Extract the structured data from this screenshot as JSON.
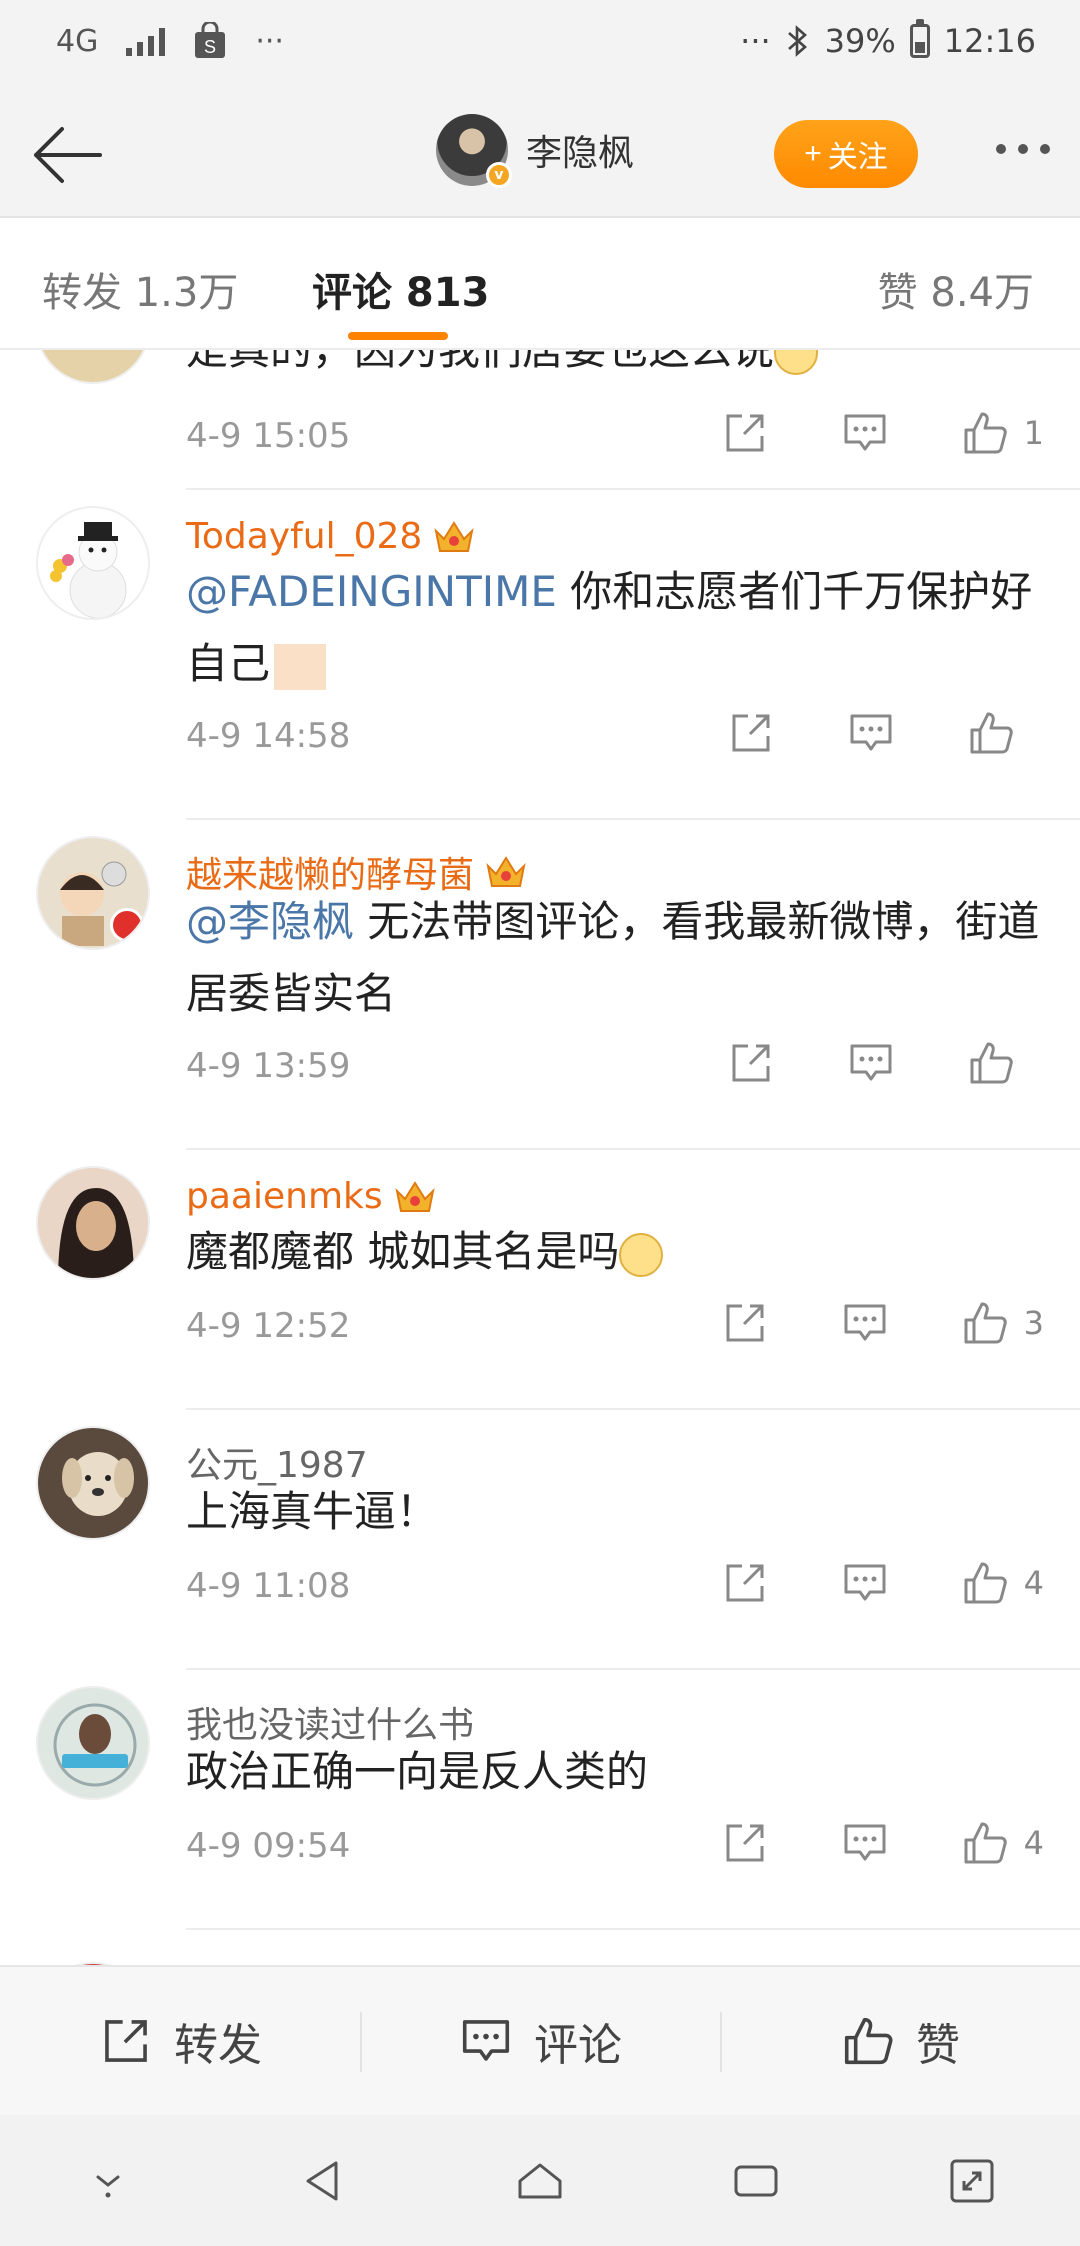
{
  "status_bar": {
    "network": "4G",
    "dots": "···",
    "right_dots": "···",
    "battery": "39%",
    "time": "12:16"
  },
  "header": {
    "username": "李隐枫",
    "follow_label": "关注",
    "follow_prefix": "+"
  },
  "tabs": {
    "reposts": "转发 1.3万",
    "comments": "评论 813",
    "likes": "赞 8.4万"
  },
  "comments": [
    {
      "partial_text": "是真的，因为我们居委也这么说",
      "time": "4-9 15:05",
      "likes": "1"
    },
    {
      "name": "Todayful_028",
      "mention": "@FADEINGINTIME",
      "text": " 你和志愿者们千万保护好自己",
      "time": "4-9 14:58",
      "likes": ""
    },
    {
      "name": "越来越懒的酵母菌",
      "mention": "@李隐枫",
      "text": " 无法带图评论，看我最新微博，街道居委皆实名",
      "time": "4-9 13:59",
      "likes": ""
    },
    {
      "name": "paaienmks",
      "text": "魔都魔都 城如其名是吗",
      "time": "4-9 12:52",
      "likes": "3"
    },
    {
      "name": "公元_1987",
      "text": "上海真牛逼！",
      "time": "4-9 11:08",
      "likes": "4"
    },
    {
      "name": "我也没读过什么书",
      "text": "政治正确一向是反人类的",
      "time": "4-9 09:54",
      "likes": "4"
    }
  ],
  "bottom_bar": {
    "repost": "转发",
    "comment": "评论",
    "like": "赞"
  },
  "colors": {
    "accent": "#ff8200",
    "name_orange": "#ea6b16",
    "mention_blue": "#4a76a8"
  }
}
